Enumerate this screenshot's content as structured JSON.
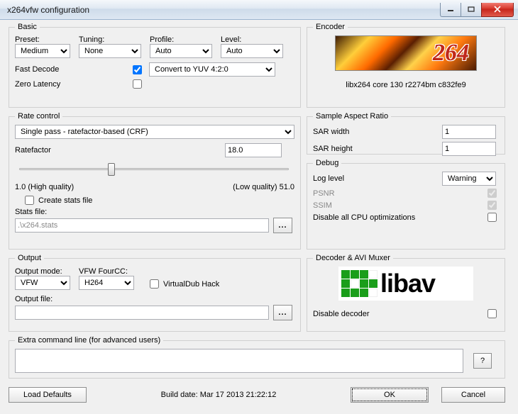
{
  "window": {
    "title": "x264vfw configuration"
  },
  "basic": {
    "legend": "Basic",
    "preset_label": "Preset:",
    "preset_value": "Medium",
    "tuning_label": "Tuning:",
    "tuning_value": "None",
    "profile_label": "Profile:",
    "profile_value": "Auto",
    "level_label": "Level:",
    "level_value": "Auto",
    "fast_decode_label": "Fast Decode",
    "fast_decode_checked": true,
    "colorspace_value": "Convert to YUV 4:2:0",
    "zero_latency_label": "Zero Latency",
    "zero_latency_checked": false
  },
  "encoder": {
    "legend": "Encoder",
    "logo_text": "264",
    "version_text": "libx264 core 130 r2274bm c832fe9"
  },
  "rate": {
    "legend": "Rate control",
    "mode_value": "Single pass - ratefactor-based (CRF)",
    "ratefactor_label": "Ratefactor",
    "ratefactor_value": "18.0",
    "slider_min_label": "1.0 (High quality)",
    "slider_max_label": "(Low quality) 51.0",
    "create_stats_label": "Create stats file",
    "create_stats_checked": false,
    "stats_file_label": "Stats file:",
    "stats_file_value": ".\\x264.stats",
    "browse": "..."
  },
  "sar": {
    "legend": "Sample Aspect Ratio",
    "width_label": "SAR width",
    "width_value": "1",
    "height_label": "SAR height",
    "height_value": "1"
  },
  "debug": {
    "legend": "Debug",
    "loglevel_label": "Log level",
    "loglevel_value": "Warning",
    "psnr_label": "PSNR",
    "psnr_checked": true,
    "ssim_label": "SSIM",
    "ssim_checked": true,
    "disable_cpu_label": "Disable all CPU optimizations",
    "disable_cpu_checked": false
  },
  "output": {
    "legend": "Output",
    "mode_label": "Output mode:",
    "mode_value": "VFW",
    "fourcc_label": "VFW FourCC:",
    "fourcc_value": "H264",
    "vdub_label": "VirtualDub Hack",
    "vdub_checked": false,
    "file_label": "Output file:",
    "file_value": "",
    "browse": "..."
  },
  "decoder": {
    "legend": "Decoder & AVI Muxer",
    "libav_text": "libav",
    "disable_label": "Disable decoder",
    "disable_checked": false
  },
  "extra": {
    "legend": "Extra command line (for advanced users)",
    "value": "",
    "help": "?"
  },
  "footer": {
    "load_defaults": "Load Defaults",
    "build_date": "Build date: Mar 17 2013 21:22:12",
    "ok": "OK",
    "cancel": "Cancel"
  }
}
